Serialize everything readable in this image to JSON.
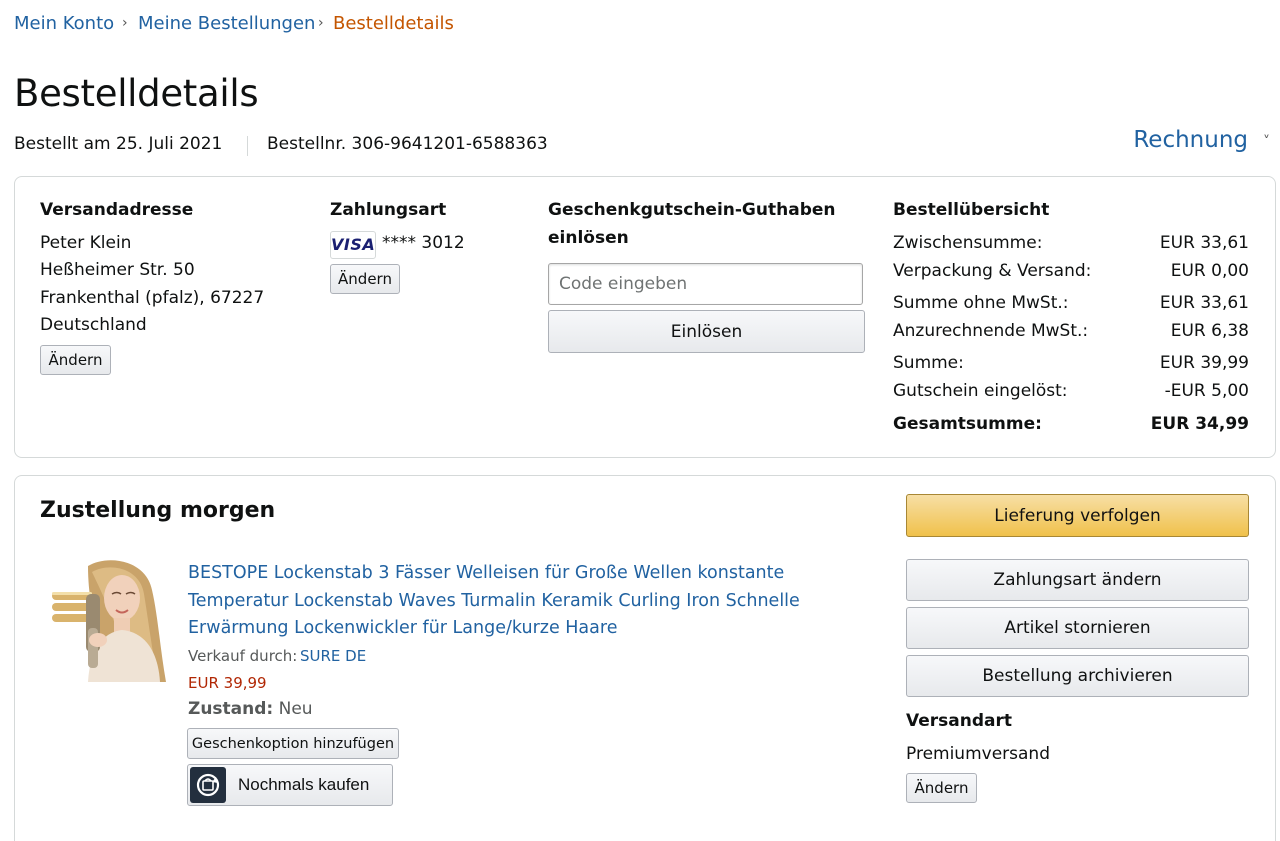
{
  "breadcrumb": {
    "items": [
      "Mein Konto",
      "Meine Bestellungen"
    ],
    "current": "Bestelldetails",
    "separator": "›"
  },
  "page": {
    "title": "Bestelldetails",
    "ordered_on": "Bestellt am 25. Juli 2021",
    "order_number": "Bestellnr. 306-9641201-6588363",
    "invoice_label": "Rechnung",
    "invoice_chevron": "˅"
  },
  "shipping_address": {
    "heading": "Versandadresse",
    "lines": [
      "Peter Klein",
      "Heßheimer Str. 50",
      "Frankenthal (pfalz), 67227",
      "Deutschland"
    ],
    "change_label": "Ändern"
  },
  "payment": {
    "heading": "Zahlungsart",
    "card_brand": "VISA",
    "card_number": "**** 3012",
    "change_label": "Ändern"
  },
  "gift_card": {
    "heading_line1": "Geschenkgutschein-Guthaben",
    "heading_line2": "einlösen",
    "placeholder": "Code eingeben",
    "redeem_label": "Einlösen"
  },
  "summary": {
    "heading": "Bestellübersicht",
    "rows": [
      {
        "label": "Zwischensumme:",
        "value": "EUR 33,61"
      },
      {
        "label": "Verpackung & Versand:",
        "value": "EUR 0,00"
      },
      {
        "label": "Summe ohne MwSt.:",
        "value": "EUR 33,61"
      },
      {
        "label": "Anzurechnende MwSt.:",
        "value": "EUR 6,38"
      },
      {
        "label": "Summe:",
        "value": "EUR 39,99"
      },
      {
        "label": "Gutschein eingelöst:",
        "value": "-EUR 5,00"
      },
      {
        "label": "Gesamtsumme:",
        "value": "EUR 34,99"
      }
    ]
  },
  "delivery": {
    "heading": "Zustellung morgen",
    "product": {
      "title": "BESTOPE Lockenstab 3 Fässer Welleisen für Große Wellen konstante Temperatur Lockenstab Waves Turmalin Keramik Curling Iron Schnelle Erwärmung Lockenwickler für Lange/kurze Haare",
      "sold_by_label": "Verkauf durch:",
      "seller": "SURE DE",
      "price": "EUR 39,99",
      "condition_label": "Zustand:",
      "condition_value": "Neu",
      "gift_option_label": "Geschenkoption hinzufügen",
      "buy_again_label": "Nochmals kaufen"
    },
    "actions": {
      "track": "Lieferung verfolgen",
      "change_payment": "Zahlungsart ändern",
      "cancel": "Artikel stornieren",
      "archive": "Bestellung archivieren"
    },
    "shipping_method": {
      "heading": "Versandart",
      "value": "Premiumversand",
      "change_label": "Ändern"
    }
  },
  "colors": {
    "link": "#2162a1",
    "breadcrumb_current": "#c45500",
    "price": "#b12704",
    "primary_button": "#f0c14b",
    "visa_blue": "#1a1f71"
  }
}
